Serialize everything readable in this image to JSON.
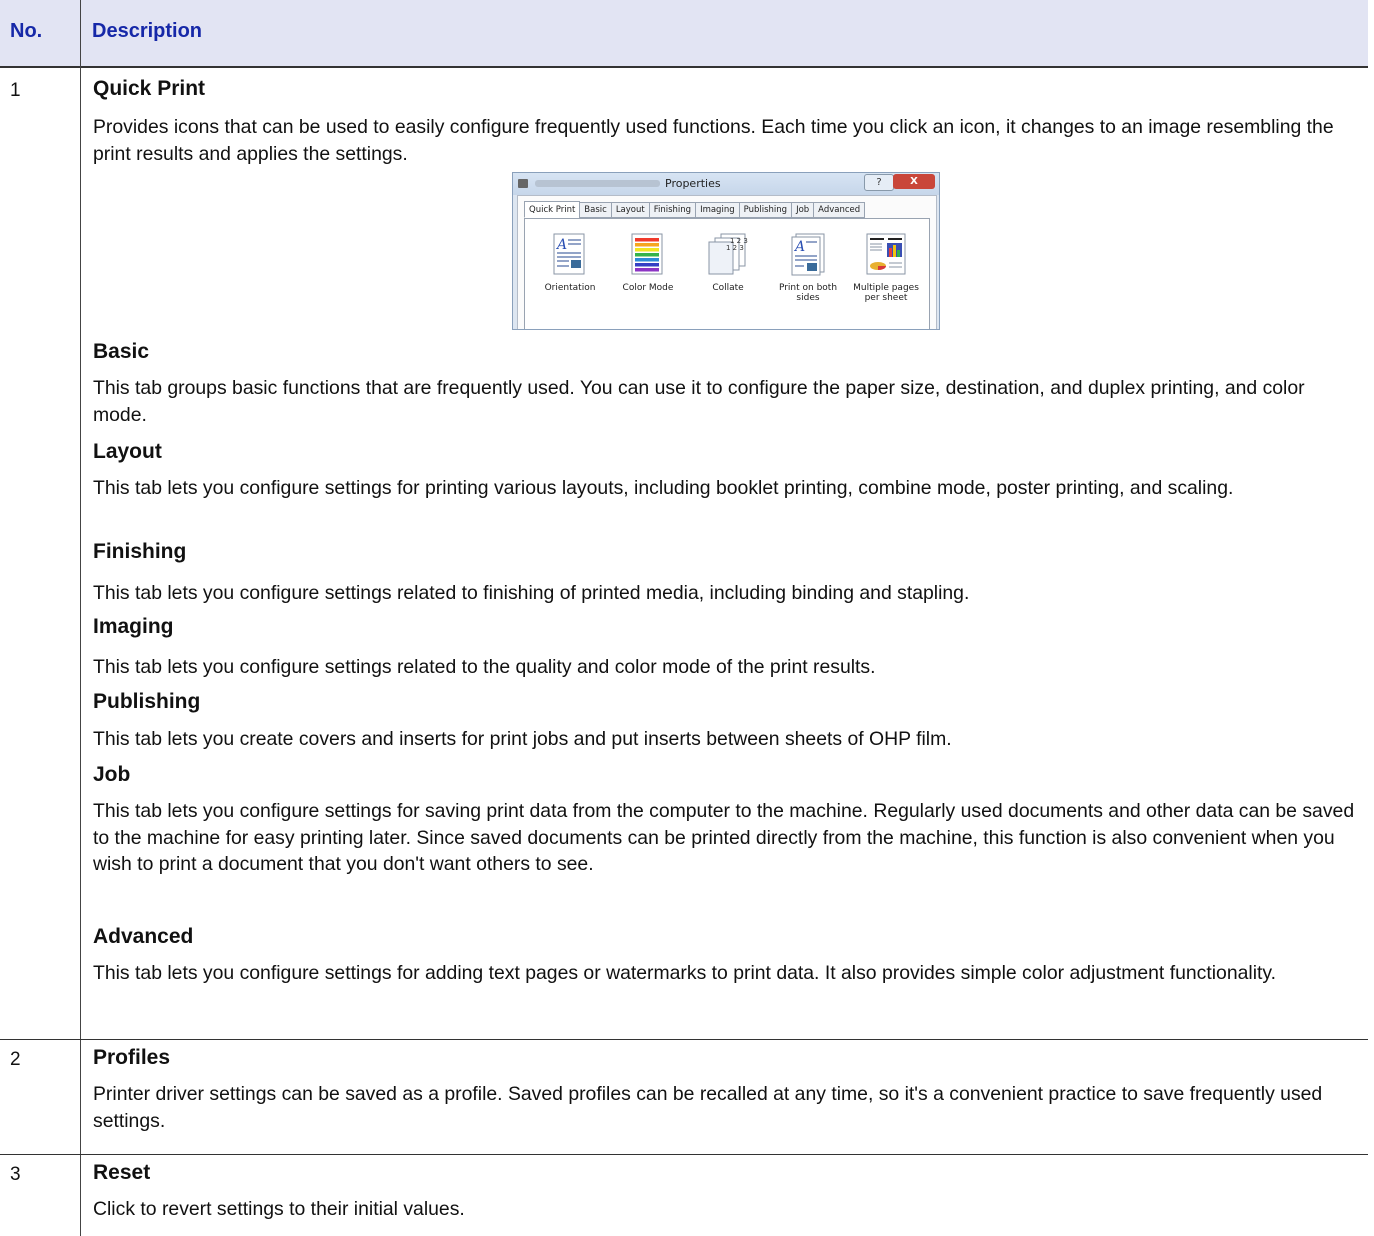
{
  "header": {
    "no_label": "No.",
    "description_label": "Description"
  },
  "rows": [
    {
      "no": "1",
      "entries": [
        {
          "title": "Quick Print",
          "text": "Provides icons that can be used to easily configure frequently used functions. Each time you click an icon, it changes to an image resembling the print results and applies the settings."
        },
        {
          "title": "Basic",
          "text": "This tab groups basic functions that are frequently used. You can use it to configure the paper size, destination, and duplex printing, and color mode."
        },
        {
          "title": "Layout",
          "text": "This tab lets you configure settings for printing various layouts, including booklet printing, combine mode, poster printing, and scaling."
        },
        {
          "title": "Finishing",
          "text": "This tab lets you configure settings related to finishing of printed media, including binding and stapling."
        },
        {
          "title": "Imaging",
          "text": "This tab lets you configure settings related to the quality and color mode of the print results."
        },
        {
          "title": "Publishing",
          "text": "This tab lets you create covers and inserts for print jobs and put inserts between sheets of OHP film."
        },
        {
          "title": "Job",
          "text": "This tab lets you configure settings for saving print data from the computer to the machine. Regularly used documents and other data can be saved to the machine for easy printing later. Since saved documents can be printed directly from the machine, this function is also convenient when you wish to print a document that you don't want others to see."
        },
        {
          "title": "Advanced",
          "text": "This tab lets you configure settings for adding text pages or watermarks to print data. It also provides simple color adjustment functionality."
        }
      ]
    },
    {
      "no": "2",
      "entries": [
        {
          "title": "Profiles",
          "text": "Printer driver settings can be saved as a profile. Saved profiles can be recalled at any time, so it's a convenient practice to save frequently used settings."
        }
      ]
    },
    {
      "no": "3",
      "entries": [
        {
          "title": "Reset",
          "text": "Click to revert settings to their initial values."
        }
      ]
    }
  ],
  "dialog": {
    "title": "Properties",
    "help_button": "?",
    "close_button": "X",
    "tabs": [
      "Quick Print",
      "Basic",
      "Layout",
      "Finishing",
      "Imaging",
      "Publishing",
      "Job",
      "Advanced"
    ],
    "quick_items": [
      {
        "label": "Orientation",
        "icon": "orientation-icon"
      },
      {
        "label": "Color Mode",
        "icon": "color-mode-icon"
      },
      {
        "label": "Collate",
        "icon": "collate-icon"
      },
      {
        "label": "Print on both sides",
        "icon": "duplex-icon"
      },
      {
        "label": "Multiple pages per sheet",
        "icon": "multiple-pages-icon"
      }
    ],
    "colors": {
      "color_bars": [
        "#f03a2c",
        "#f6a520",
        "#f1e522",
        "#34b34a",
        "#2c8bd7",
        "#3340c4",
        "#8c34c4"
      ]
    }
  }
}
